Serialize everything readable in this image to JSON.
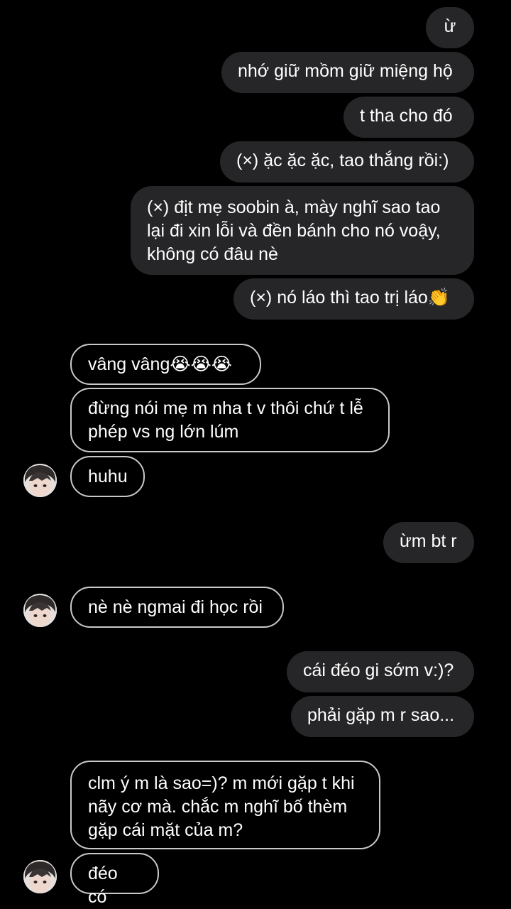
{
  "messages": {
    "m1": "ừ",
    "m2": "nhớ giữ mồm giữ miệng hộ",
    "m3": "t tha cho đó",
    "m4": "(×) ặc ặc ặc, tao thắng rồi:)",
    "m5": "(×) địt mẹ soobin à, mày nghĩ sao tao\nlại đi xin lỗi và đền bánh cho nó voậy,\nkhông có đâu nè",
    "m6": "(×) nó láo thì tao trị láo👏",
    "m7": "vâng vâng😭😭😭",
    "m8": "đừng nói mẹ m nha t v thôi chứ t lễ\nphép vs ng lớn lúm",
    "m9": "huhu",
    "m10": "ừm bt r",
    "m11": "nè nè ngmai đi học rồi",
    "m12": "cái đéo gi sớm v:)?",
    "m13": "phải gặp m r sao...",
    "m14": "clm ý m là sao=)? m mới gặp t khi\nnãy cơ mà. chắc m nghĩ bố thèm\ngặp cái mặt của m?",
    "m15": "đéo có"
  },
  "colors": {
    "background": "#000000",
    "outgoing_bubble": "#262628",
    "incoming_border": "#c9c9c9",
    "text": "#ffffff"
  },
  "icons": {
    "avatar": "contact-avatar"
  }
}
